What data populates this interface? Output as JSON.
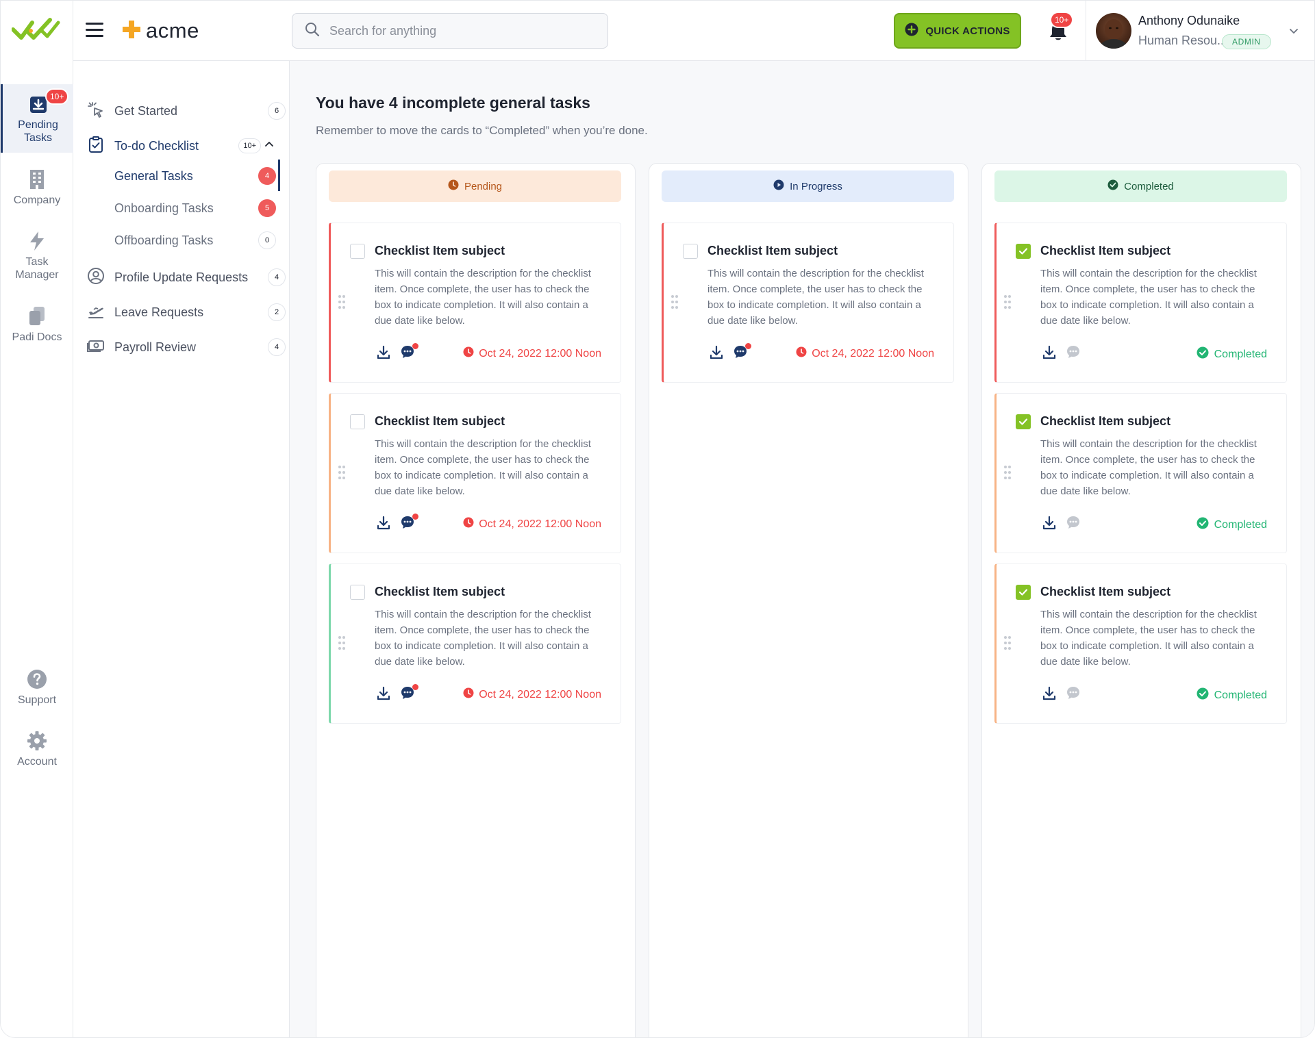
{
  "colors": {
    "accent_green": "#84c225",
    "navy": "#1f3a6b",
    "danger": "#ef4444",
    "success": "#22b573",
    "pending_bg": "#fde9da",
    "in_progress_bg": "#e3ecfb",
    "completed_bg": "#dcf6e7"
  },
  "rail": {
    "logo": "checkmark-logo",
    "items": [
      {
        "label": "Pending Tasks",
        "icon": "download-tray-icon",
        "badge": "10+"
      },
      {
        "label": "Company",
        "icon": "building-icon"
      },
      {
        "label": "Task Manager",
        "icon": "lightning-icon"
      },
      {
        "label": "Padi Docs",
        "icon": "documents-icon"
      },
      {
        "label": "Support",
        "icon": "question-icon"
      },
      {
        "label": "Account",
        "icon": "gear-icon"
      }
    ]
  },
  "header": {
    "brand": "acme",
    "search_placeholder": "Search for anything",
    "quick_actions": "QUICK ACTIONS",
    "notifications_badge": "10+",
    "user": {
      "name": "Anthony Odunaike",
      "role": "Human Resou...",
      "badge": "ADMIN"
    }
  },
  "submenu": {
    "items": [
      {
        "label": "Get Started",
        "count": "6",
        "icon": "cursor-click-icon"
      },
      {
        "label": "To-do Checklist",
        "count": "10+",
        "icon": "clipboard-check-icon"
      },
      {
        "label": "Profile Update Requests",
        "count": "4",
        "icon": "user-circle-icon"
      },
      {
        "label": "Leave Requests",
        "count": "2",
        "icon": "plane-takeoff-icon"
      },
      {
        "label": "Payroll Review",
        "count": "4",
        "icon": "money-icon"
      }
    ],
    "sub_items": [
      {
        "label": "General Tasks",
        "count": "4"
      },
      {
        "label": "Onboarding Tasks",
        "count": "5"
      },
      {
        "label": "Offboarding Tasks",
        "count": "0"
      }
    ]
  },
  "main": {
    "title": "You have 4 incomplete general tasks",
    "subtitle": "Remember to move the cards to “Completed” when you’re done.",
    "columns": [
      {
        "label": "Pending",
        "cards": [
          {
            "title": "Checklist Item subject",
            "description": "This will contain the description for the checklist item. Once complete, the user has to check the box to indicate completion. It will also contain a due date like below.",
            "due": "Oct 24, 2022 12:00 Noon"
          },
          {
            "title": "Checklist Item subject",
            "description": "This will contain the description for the checklist item. Once complete, the user has to check the box to indicate completion. It will also contain a due date like below.",
            "due": "Oct 24, 2022 12:00 Noon"
          },
          {
            "title": "Checklist Item subject",
            "description": "This will contain the description for the checklist item. Once complete, the user has to check the box to indicate completion. It will also contain a due date like below.",
            "due": "Oct 24, 2022 12:00 Noon"
          }
        ]
      },
      {
        "label": "In Progress",
        "cards": [
          {
            "title": "Checklist Item subject",
            "description": "This will contain the description for the checklist item. Once complete, the user has to check the box to indicate completion. It will also contain a due date like below.",
            "due": "Oct 24, 2022 12:00 Noon"
          }
        ]
      },
      {
        "label": "Completed",
        "cards": [
          {
            "title": "Checklist Item subject",
            "description": "This will contain the description for the checklist item. Once complete, the user has to check the box to indicate completion. It will also contain a due date like below.",
            "status": "Completed"
          },
          {
            "title": "Checklist Item subject",
            "description": "This will contain the description for the checklist item. Once complete, the user has to check the box to indicate completion. It will also contain a due date like below.",
            "status": "Completed"
          },
          {
            "title": "Checklist Item subject",
            "description": "This will contain the description for the checklist item. Once complete, the user has to check the box to indicate completion. It will also contain a due date like below.",
            "status": "Completed"
          }
        ]
      }
    ]
  }
}
